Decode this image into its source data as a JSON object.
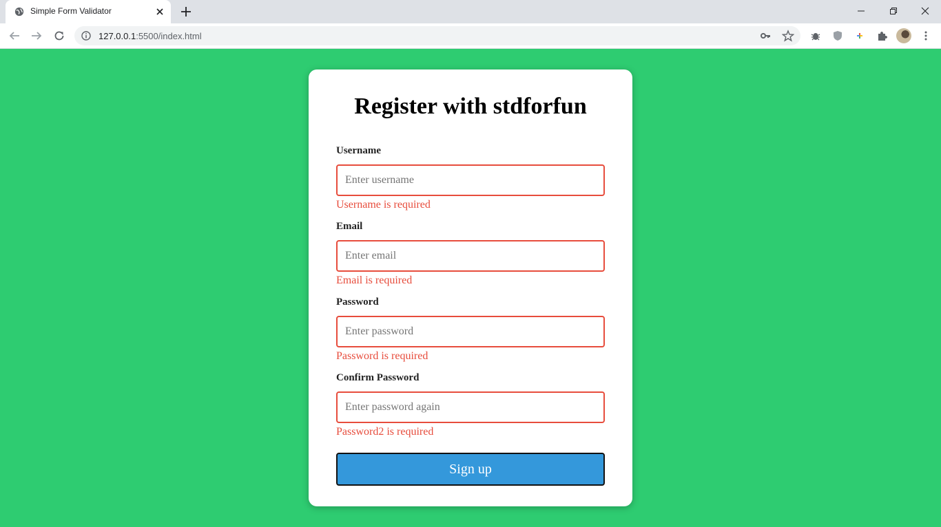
{
  "browser": {
    "tab_title": "Simple Form Validator",
    "url_host": "127.0.0.1",
    "url_rest": ":5500/index.html"
  },
  "form": {
    "title": "Register with stdforfun",
    "fields": [
      {
        "label": "Username",
        "placeholder": "Enter username",
        "error": "Username is required"
      },
      {
        "label": "Email",
        "placeholder": "Enter email",
        "error": "Email is required"
      },
      {
        "label": "Password",
        "placeholder": "Enter password",
        "error": "Password is required"
      },
      {
        "label": "Confirm Password",
        "placeholder": "Enter password again",
        "error": "Password2 is required"
      }
    ],
    "submit_label": "Sign up"
  },
  "colors": {
    "background": "#2ecc71",
    "error": "#e74c3c",
    "button": "#3498db"
  }
}
